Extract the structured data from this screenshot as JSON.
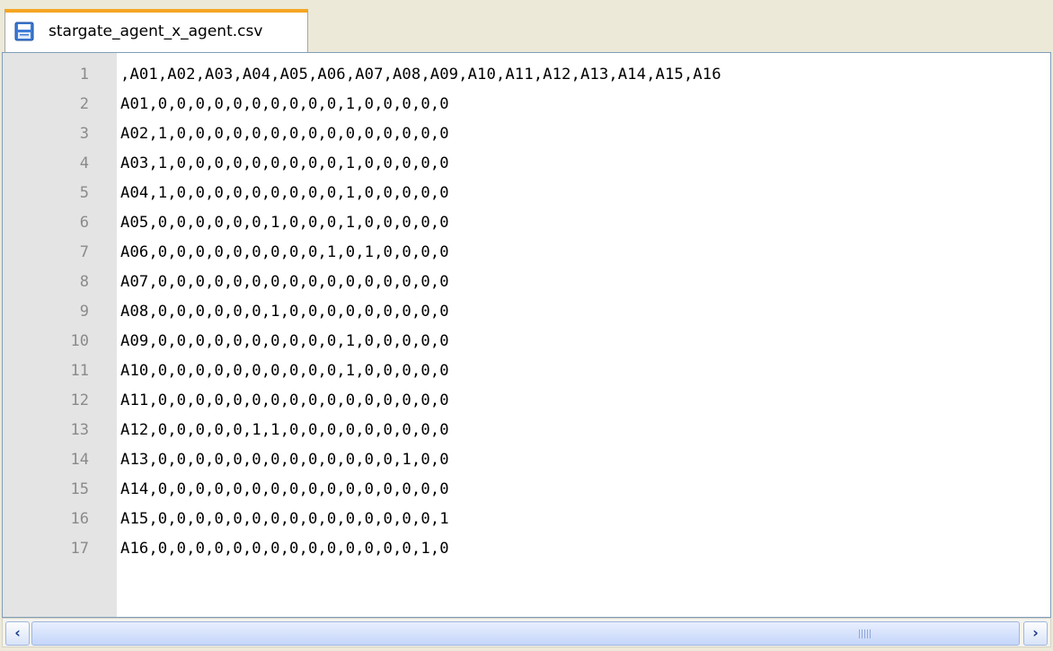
{
  "tab": {
    "filename": "stargate_agent_x_agent.csv",
    "icon": "save-disk-icon"
  },
  "editor": {
    "lines": [
      {
        "num": "1",
        "text": ",A01,A02,A03,A04,A05,A06,A07,A08,A09,A10,A11,A12,A13,A14,A15,A16"
      },
      {
        "num": "2",
        "text": "A01,0,0,0,0,0,0,0,0,0,0,1,0,0,0,0,0"
      },
      {
        "num": "3",
        "text": "A02,1,0,0,0,0,0,0,0,0,0,0,0,0,0,0,0"
      },
      {
        "num": "4",
        "text": "A03,1,0,0,0,0,0,0,0,0,0,1,0,0,0,0,0"
      },
      {
        "num": "5",
        "text": "A04,1,0,0,0,0,0,0,0,0,0,1,0,0,0,0,0"
      },
      {
        "num": "6",
        "text": "A05,0,0,0,0,0,0,1,0,0,0,1,0,0,0,0,0"
      },
      {
        "num": "7",
        "text": "A06,0,0,0,0,0,0,0,0,0,1,0,1,0,0,0,0"
      },
      {
        "num": "8",
        "text": "A07,0,0,0,0,0,0,0,0,0,0,0,0,0,0,0,0"
      },
      {
        "num": "9",
        "text": "A08,0,0,0,0,0,0,1,0,0,0,0,0,0,0,0,0"
      },
      {
        "num": "10",
        "text": "A09,0,0,0,0,0,0,0,0,0,0,1,0,0,0,0,0"
      },
      {
        "num": "11",
        "text": "A10,0,0,0,0,0,0,0,0,0,0,1,0,0,0,0,0"
      },
      {
        "num": "12",
        "text": "A11,0,0,0,0,0,0,0,0,0,0,0,0,0,0,0,0"
      },
      {
        "num": "13",
        "text": "A12,0,0,0,0,0,1,1,0,0,0,0,0,0,0,0,0"
      },
      {
        "num": "14",
        "text": "A13,0,0,0,0,0,0,0,0,0,0,0,0,0,1,0,0"
      },
      {
        "num": "15",
        "text": "A14,0,0,0,0,0,0,0,0,0,0,0,0,0,0,0,0"
      },
      {
        "num": "16",
        "text": "A15,0,0,0,0,0,0,0,0,0,0,0,0,0,0,0,1"
      },
      {
        "num": "17",
        "text": "A16,0,0,0,0,0,0,0,0,0,0,0,0,0,0,1,0"
      }
    ]
  },
  "scrollbar": {
    "left_icon": "chevron-left-icon",
    "right_icon": "chevron-right-icon"
  }
}
